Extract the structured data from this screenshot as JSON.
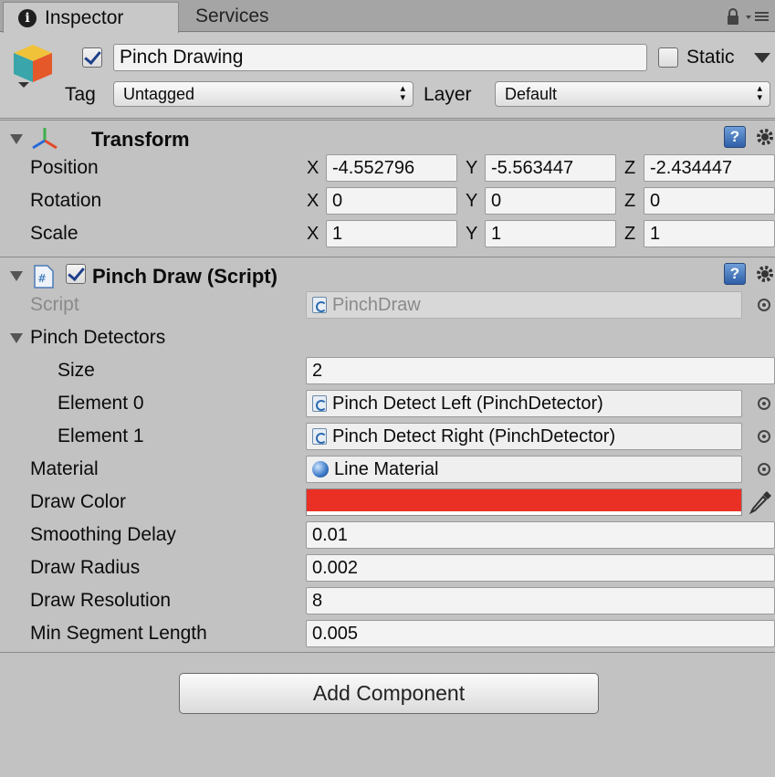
{
  "tabs": [
    {
      "label": "Inspector",
      "icon": "info-icon",
      "active": true
    },
    {
      "label": "Services",
      "active": false
    }
  ],
  "gameobject": {
    "active": true,
    "name": "Pinch Drawing",
    "static_label": "Static",
    "static_checked": false,
    "tag_label": "Tag",
    "tag_value": "Untagged",
    "layer_label": "Layer",
    "layer_value": "Default"
  },
  "transform": {
    "title": "Transform",
    "rows": [
      {
        "label": "Position",
        "x": "-4.552796",
        "y": "-5.563447",
        "z": "-2.434447"
      },
      {
        "label": "Rotation",
        "x": "0",
        "y": "0",
        "z": "0"
      },
      {
        "label": "Scale",
        "x": "1",
        "y": "1",
        "z": "1"
      }
    ],
    "axis_labels": {
      "x": "X",
      "y": "Y",
      "z": "Z"
    }
  },
  "script_component": {
    "title": "Pinch Draw (Script)",
    "enabled": true,
    "script_label": "Script",
    "script_value": "PinchDraw",
    "pinch_detectors_label": "Pinch Detectors",
    "size_label": "Size",
    "size_value": "2",
    "elements": [
      {
        "label": "Element 0",
        "value": "Pinch Detect Left (PinchDetector)"
      },
      {
        "label": "Element 1",
        "value": "Pinch Detect Right (PinchDetector)"
      }
    ],
    "material_label": "Material",
    "material_value": "Line Material",
    "draw_color_label": "Draw Color",
    "draw_color": "#ea3025",
    "smoothing_delay_label": "Smoothing Delay",
    "smoothing_delay_value": "0.01",
    "draw_radius_label": "Draw Radius",
    "draw_radius_value": "0.002",
    "draw_resolution_label": "Draw Resolution",
    "draw_resolution_value": "8",
    "min_segment_label": "Min Segment Length",
    "min_segment_value": "0.005"
  },
  "add_component_label": "Add Component",
  "colors": {
    "panel_bg": "#c2c2c2",
    "help_blue": "#3b6cb5"
  }
}
